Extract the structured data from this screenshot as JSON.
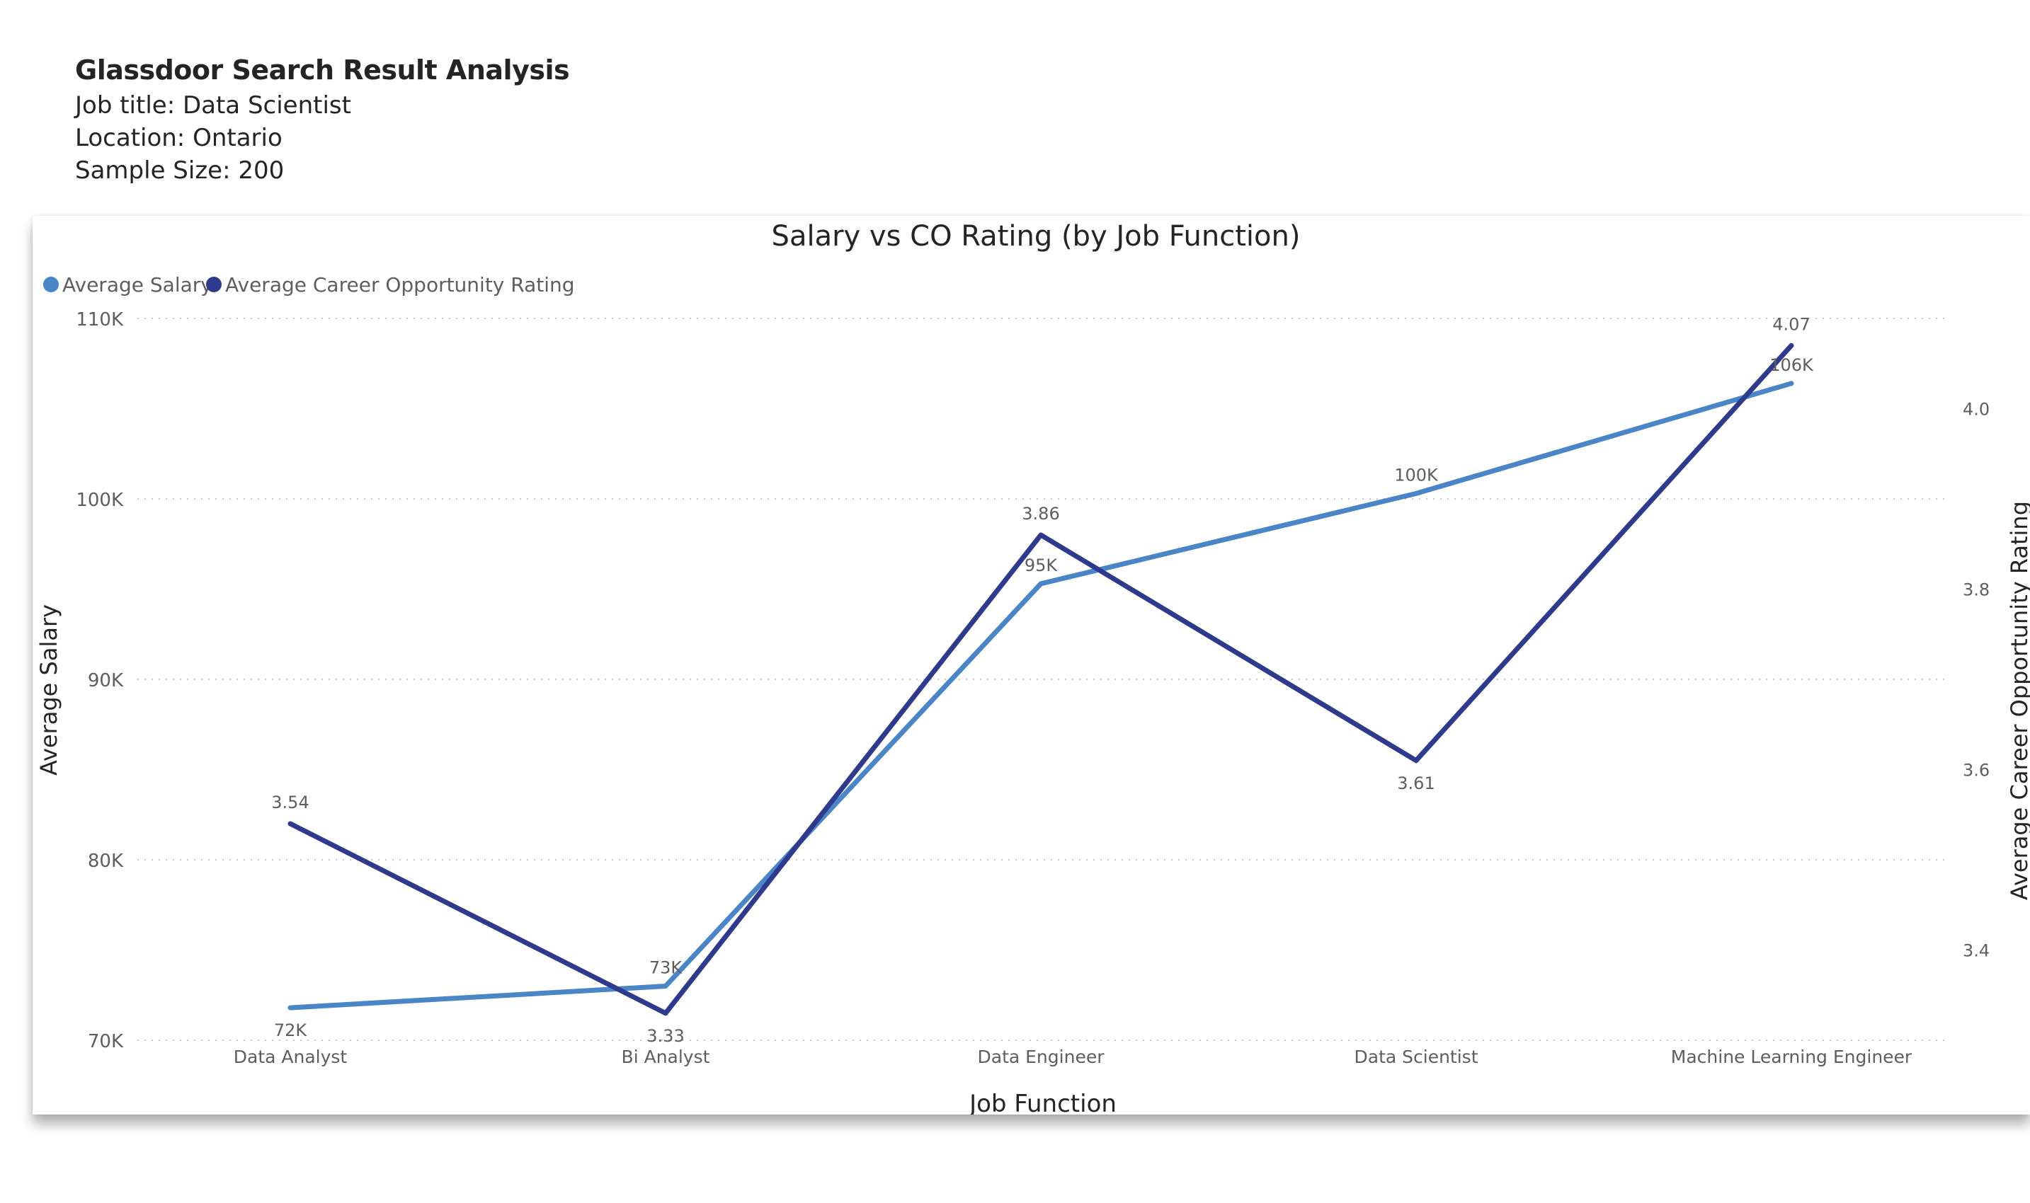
{
  "report": {
    "title": "Glassdoor Search Result Analysis",
    "job_title": "Job title:  Data Scientist",
    "location": "Location: Ontario",
    "sample_size": "Sample Size: 200"
  },
  "chart_data": {
    "type": "line",
    "title": "Salary vs CO Rating (by Job Function)",
    "xlabel": "Job Function",
    "ylabel": "Average Salary",
    "y2label": "Average Career Opportunity Rating",
    "categories": [
      "Data Analyst",
      "Bi Analyst",
      "Data Engineer",
      "Data Scientist",
      "Machine Learning Engineer"
    ],
    "ylim": [
      70000,
      110000
    ],
    "y_ticks": [
      {
        "value": 70000,
        "label": "70K"
      },
      {
        "value": 80000,
        "label": "80K"
      },
      {
        "value": 90000,
        "label": "90K"
      },
      {
        "value": 100000,
        "label": "100K"
      },
      {
        "value": 110000,
        "label": "110K"
      }
    ],
    "y2lim": [
      3.3,
      4.1
    ],
    "y2_ticks": [
      {
        "value": 3.4,
        "label": "3.4"
      },
      {
        "value": 3.6,
        "label": "3.6"
      },
      {
        "value": 3.8,
        "label": "3.8"
      },
      {
        "value": 4.0,
        "label": "4.0"
      }
    ],
    "grid": true,
    "legend_position": "top-left",
    "series": [
      {
        "name": "Average Salary",
        "axis": "left",
        "color": "#4a85c8",
        "values": [
          71800,
          73000,
          95300,
          100300,
          106400
        ],
        "labels": [
          "72K",
          "73K",
          "95K",
          "100K",
          "106K"
        ]
      },
      {
        "name": "Average Career Opportunity Rating",
        "axis": "right",
        "color": "#2e3a8c",
        "values": [
          3.54,
          3.33,
          3.86,
          3.61,
          4.07
        ],
        "labels": [
          "3.54",
          "3.33",
          "3.86",
          "3.61",
          "4.07"
        ]
      }
    ]
  }
}
